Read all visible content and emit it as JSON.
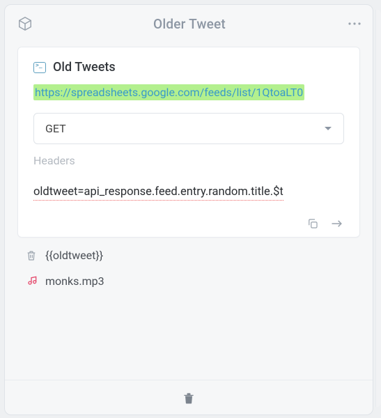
{
  "header": {
    "title": "Older Tweet"
  },
  "card": {
    "title": "Old Tweets",
    "url": "https://spreadsheets.google.com/feeds/list/1QtoaLT0",
    "method": "GET",
    "headers_label": "Headers",
    "expression": "oldtweet=api_response.feed.entry.random.title.$t"
  },
  "items": {
    "tweet_var": "{{oldtweet}}",
    "audio_file": "monks.mp3"
  }
}
